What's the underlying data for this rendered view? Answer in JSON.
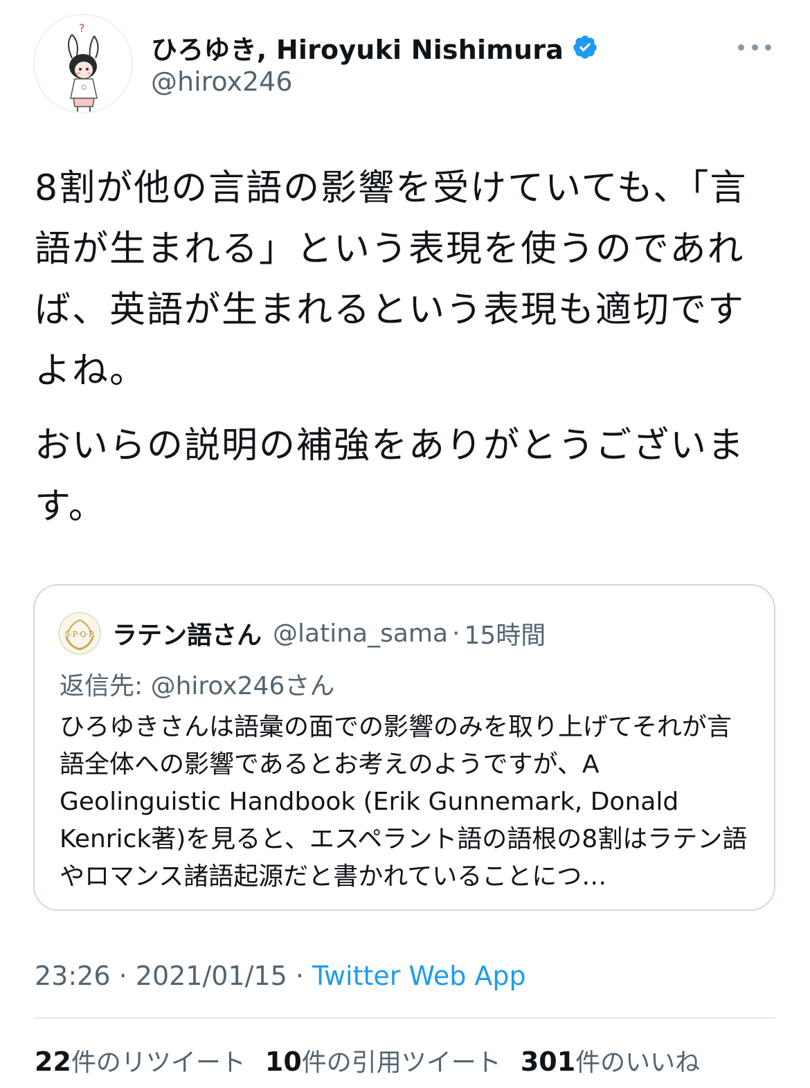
{
  "author": {
    "display_name": "ひろゆき, Hiroyuki Nishimura",
    "handle": "@hirox246",
    "verified": true,
    "avatar_icon": "anime-character-avatar"
  },
  "tweet": {
    "paragraphs": [
      "8割が他の言語の影響を受けていても、「言語が生まれる」という表現を使うのであれば、英語が生まれるという表現も適切ですよね。",
      "おいらの説明の補強をありがとうございます。"
    ]
  },
  "quote": {
    "display_name": "ラテン語さん",
    "handle": "@latina_sama",
    "separator": "·",
    "time": "15時間",
    "reply_prefix": "返信先: ",
    "reply_to": "@hirox246さん",
    "text": "ひろゆきさんは語彙の面での影響のみを取り上げてそれが言語全体への影響であるとお考えのようですが、A Geolinguistic Handbook (Erik Gunnemark, Donald Kenrick著)を見ると、エスペラント語の語根の8割はラテン語やロマンス諸語起源だと書かれていることにつ…",
    "avatar_icon": "spqr-laurel-icon"
  },
  "meta": {
    "time": "23:26",
    "sep1": " · ",
    "date": "2021/01/15",
    "sep2": " · ",
    "source": "Twitter Web App"
  },
  "stats": {
    "retweets": {
      "num": "22",
      "label": "件のリツイート"
    },
    "quotes": {
      "num": "10",
      "label": "件の引用ツイート"
    },
    "likes": {
      "num": "301",
      "label": "件のいいね"
    }
  },
  "colors": {
    "text": "#0f1419",
    "secondary": "#536471",
    "link": "#1d9bf0",
    "verified": "#1d9bf0",
    "border": "#cfd9de"
  }
}
